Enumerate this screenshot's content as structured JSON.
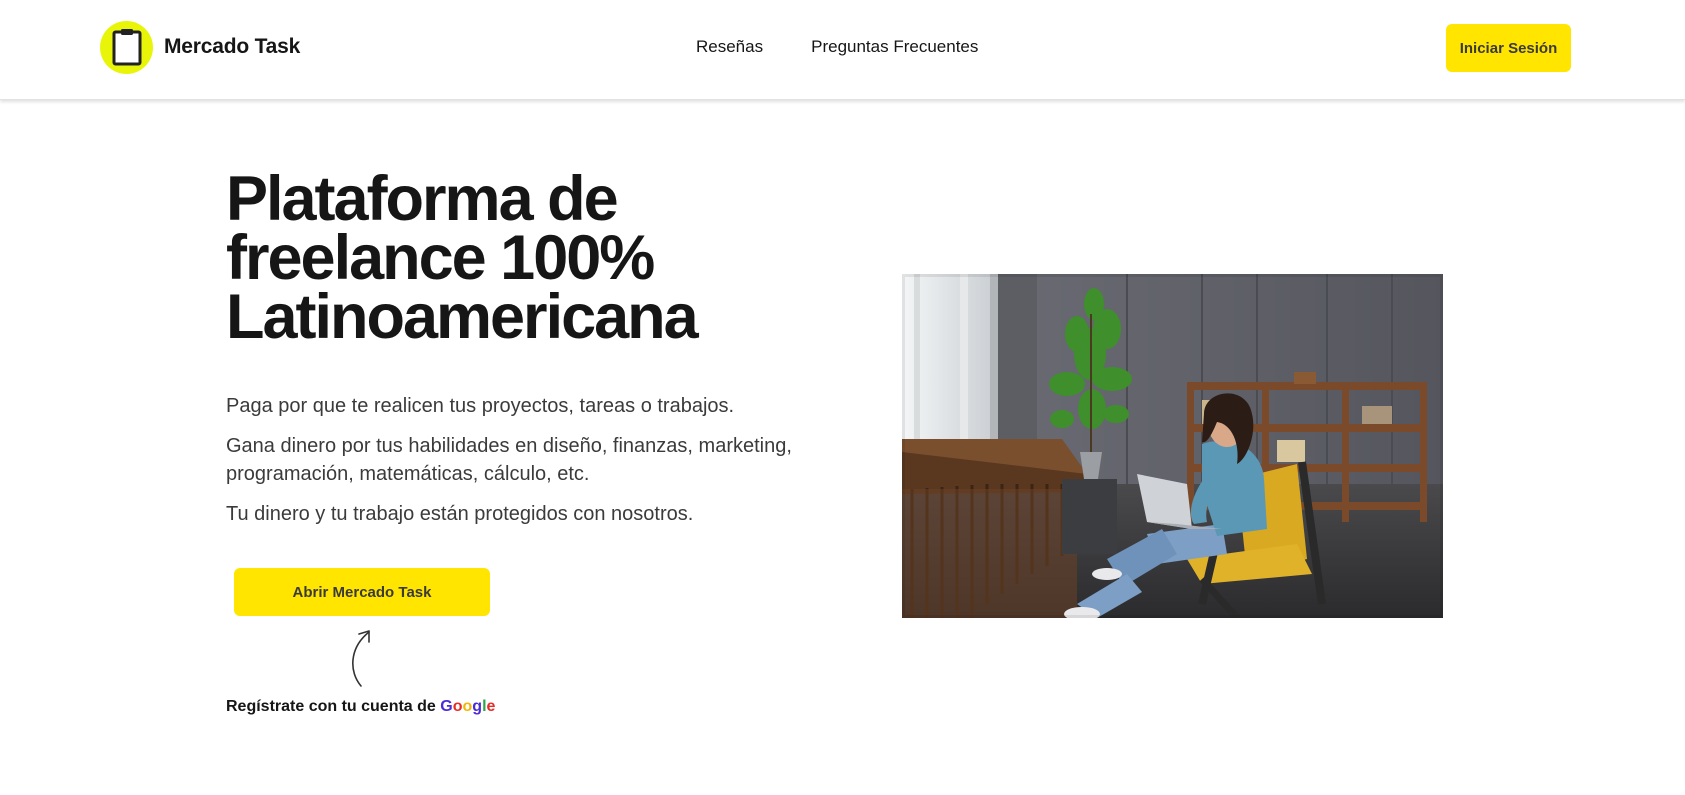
{
  "header": {
    "brand_name": "Mercado Task",
    "nav": [
      {
        "label": "Reseñas"
      },
      {
        "label": "Preguntas Frecuentes"
      }
    ],
    "login_label": "Iniciar Sesión"
  },
  "hero": {
    "title_lines": [
      "Plataforma de",
      "freelance 100%",
      "Latinoamericana"
    ],
    "paragraphs": [
      "Paga por que te realicen tus proyectos, tareas o trabajos.",
      "Gana dinero por tus habilidades en diseño, finanzas, marketing, programación, matemáticas, cálculo, etc.",
      "Tu dinero y tu trabajo están protegidos con nosotros."
    ],
    "cta_label": "Abrir Mercado Task",
    "google_prefix": "Regístrate con tu cuenta de",
    "google_word": [
      "G",
      "o",
      "o",
      "g",
      "l",
      "e"
    ]
  },
  "colors": {
    "accent": "#ffe500",
    "logo": "#e8f509"
  },
  "icons": {
    "logo": "clipboard-icon",
    "arrow": "curved-arrow-up-icon"
  }
}
